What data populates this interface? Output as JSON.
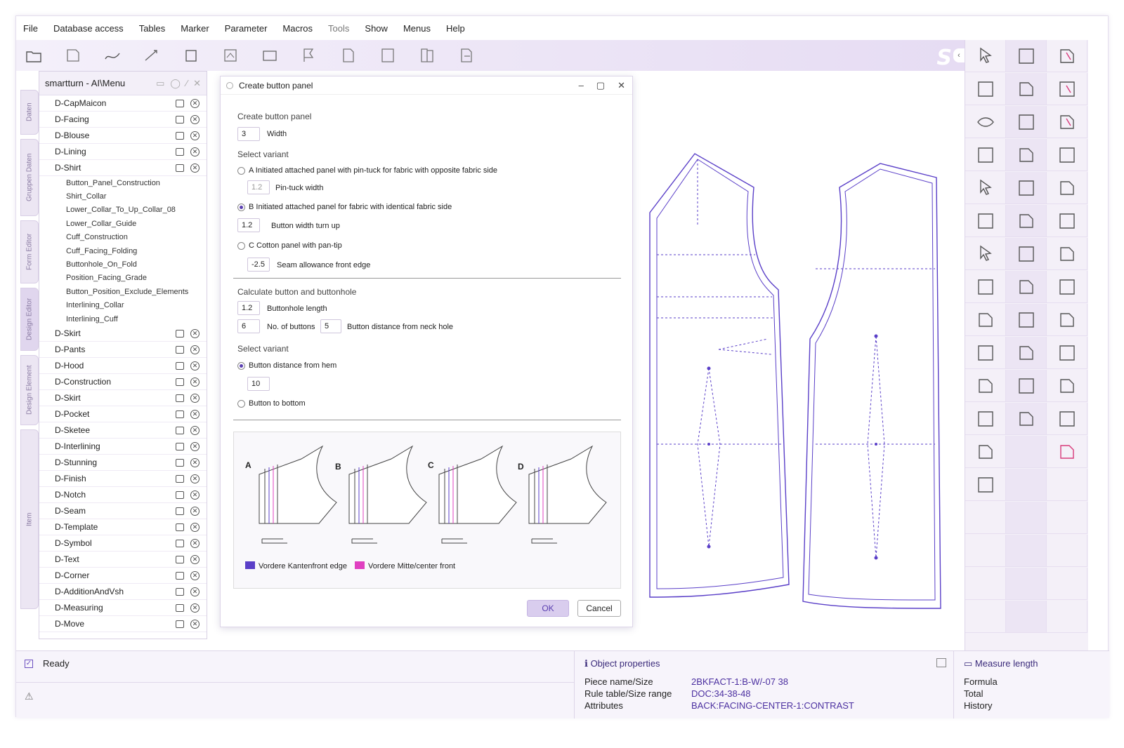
{
  "menu": [
    "File",
    "Database access",
    "Tables",
    "Marker",
    "Parameter",
    "Macros",
    "Tools",
    "Show",
    "Menus",
    "Help"
  ],
  "tree": {
    "title": "smartturn - AI\\Menu",
    "items_top": [
      "D-CapMaicon",
      "D-Facing",
      "D-Blouse",
      "D-Lining",
      "D-Shirt"
    ],
    "shirt_children": [
      "Button_Panel_Construction",
      "Shirt_Collar",
      "Lower_Collar_To_Up_Collar_08",
      "Lower_Collar_Guide",
      "Cuff_Construction",
      "Cuff_Facing_Folding",
      "Buttonhole_On_Fold",
      "Position_Facing_Grade",
      "Button_Position_Exclude_Elements",
      "Interlining_Collar",
      "Interlining_Cuff"
    ],
    "items_bottom": [
      "D-Skirt",
      "D-Pants",
      "D-Hood",
      "D-Construction",
      "D-Skirt",
      "D-Pocket",
      "D-Sketee",
      "D-Interlining",
      "D-Stunning",
      "D-Finish",
      "D-Notch",
      "D-Seam",
      "D-Template",
      "D-Symbol",
      "D-Text",
      "D-Corner",
      "D-AdditionAndVsh",
      "D-Measuring",
      "D-Move"
    ]
  },
  "vtabs": [
    "Daten",
    "Gruppen Daten",
    "Form Editor",
    "Design Editor",
    "Design Element",
    "Item"
  ],
  "dialog": {
    "title": "Create button panel",
    "sec1": "Create button panel",
    "width_val": "3",
    "width_label": "Width",
    "sel_variant": "Select variant",
    "optA": "A Initiated attached panel with pin-tuck for fabric with opposite fabric side",
    "pintuck_val": "1.2",
    "pintuck_label": "Pin-tuck width",
    "optB": "B Initiated attached panel for fabric with identical fabric side",
    "bw_val": "1.2",
    "bw_label": "Button width turn up",
    "optC": "C Cotton panel with pan-tip",
    "sa_val": "-2.5",
    "sa_label": "Seam allowance front edge",
    "sec2": "Calculate button and buttonhole",
    "bh_val": "1.2",
    "bh_label": "Buttonhole length",
    "nb_val": "6",
    "nb_label": "No. of buttons",
    "bd_val": "5",
    "bd_label": "Button distance from neck hole",
    "sel_variant2": "Select variant",
    "opt_hem": "Button distance from hem",
    "hem_val": "10",
    "opt_bottom": "Button to bottom",
    "preview_labels": [
      "A",
      "B",
      "C",
      "D"
    ],
    "legend1": "Vordere Kantenfront edge",
    "legend2": "Vordere Mitte/center front",
    "ok": "OK",
    "cancel": "Cancel"
  },
  "status": {
    "ready": "Ready",
    "obj_title": "Object properties",
    "rows": [
      {
        "label": "Piece name/Size",
        "value": "2BKFACT-1:B-W/-07 38"
      },
      {
        "label": "Rule table/Size range",
        "value": "DOC:34-38-48"
      },
      {
        "label": "Attributes",
        "value": "BACK:FACING-CENTER-1:CONTRAST"
      }
    ],
    "meas_title": "Measure length",
    "meas_rows": [
      "Formula",
      "Total",
      "History"
    ]
  },
  "colors": {
    "accent": "#5a3fb0",
    "pink": "#e040c0",
    "toolbar": "#e6dcf3"
  }
}
